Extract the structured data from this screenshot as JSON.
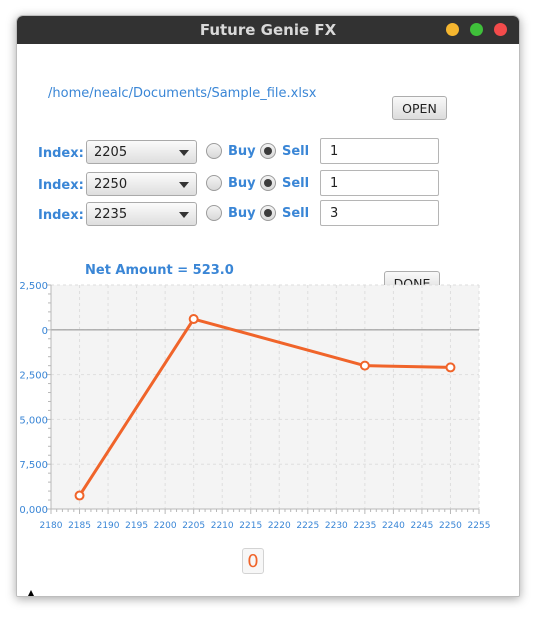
{
  "window": {
    "title": "Future Genie FX"
  },
  "file": {
    "path": "/home/nealc/Documents/Sample_file.xlsx",
    "open_label": "OPEN"
  },
  "rows": [
    {
      "label": "Index:",
      "index": "2205",
      "buy_label": "Buy",
      "sell_label": "Sell",
      "selected": "Sell",
      "qty": "1"
    },
    {
      "label": "Index:",
      "index": "2250",
      "buy_label": "Buy",
      "sell_label": "Sell",
      "selected": "Sell",
      "qty": "1"
    },
    {
      "label": "Index:",
      "index": "2235",
      "buy_label": "Buy",
      "sell_label": "Sell",
      "selected": "Sell",
      "qty": "3"
    }
  ],
  "summary": {
    "net_amount": "Net Amount = 523.0",
    "done_label": "DONE"
  },
  "colors": {
    "accent": "#3a86d6",
    "line": "#f0642a",
    "title_bar": "#323232"
  },
  "chart_data": {
    "type": "line",
    "title": "",
    "xlabel": "",
    "ylabel": "",
    "xlim": [
      2180,
      2255
    ],
    "ylim": [
      -10000,
      2500
    ],
    "x_ticks": [
      2180,
      2185,
      2190,
      2195,
      2200,
      2205,
      2210,
      2215,
      2220,
      2225,
      2230,
      2235,
      2240,
      2245,
      2250,
      2255
    ],
    "y_ticks": [
      2500,
      0,
      -2500,
      -5000,
      -7500,
      -10000
    ],
    "y_tick_labels": [
      "2,500",
      "0",
      "2,500",
      "5,000",
      "7,500",
      "0,000"
    ],
    "grid": true,
    "series": [
      {
        "x": [
          2185,
          2205,
          2235,
          2250
        ],
        "y": [
          -9250,
          600,
          -2000,
          -2100
        ]
      }
    ]
  },
  "counter": {
    "value": "0"
  }
}
